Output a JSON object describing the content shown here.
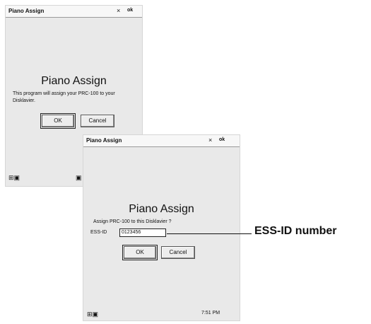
{
  "screen1": {
    "title": "Piano Assign",
    "close_glyph": "×",
    "ok_label": "ok",
    "heading": "Piano Assign",
    "message": "This program will assign your PRC-100 to your Disklavier.",
    "ok_button": "OK",
    "cancel_button": "Cancel",
    "taskbar_left_icon": "start-icon",
    "taskbar_right_icon": "tray-icon"
  },
  "screen2": {
    "title": "Piano Assign",
    "close_glyph": "×",
    "ok_label": "ok",
    "heading": "Piano Assign",
    "message": "Assign PRC-100 to this Disklavier ?",
    "essid_label": "ESS-ID",
    "essid_value": "0123456",
    "ok_button": "OK",
    "cancel_button": "Cancel",
    "taskbar_left_icon": "start-icon",
    "taskbar_right_text": "7:51 PM"
  },
  "callout": {
    "label": "ESS-ID number"
  }
}
